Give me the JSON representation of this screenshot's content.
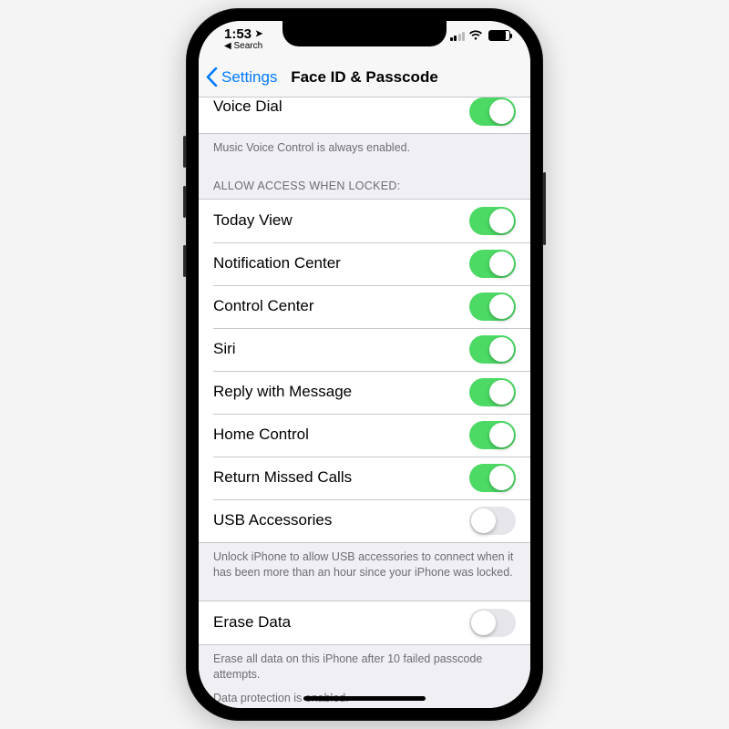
{
  "status": {
    "time": "1:53",
    "breadcrumb": "Search"
  },
  "nav": {
    "back": "Settings",
    "title": "Face ID & Passcode"
  },
  "voiceDial": {
    "label": "Voice Dial",
    "on": true,
    "footer": "Music Voice Control is always enabled."
  },
  "allowAccess": {
    "header": "Allow Access When Locked:",
    "items": [
      {
        "label": "Today View",
        "on": true
      },
      {
        "label": "Notification Center",
        "on": true
      },
      {
        "label": "Control Center",
        "on": true
      },
      {
        "label": "Siri",
        "on": true
      },
      {
        "label": "Reply with Message",
        "on": true
      },
      {
        "label": "Home Control",
        "on": true
      },
      {
        "label": "Return Missed Calls",
        "on": true
      },
      {
        "label": "USB Accessories",
        "on": false
      }
    ],
    "footer": "Unlock iPhone to allow USB accessories to connect when it has been more than an hour since your iPhone was locked."
  },
  "eraseData": {
    "label": "Erase Data",
    "on": false,
    "footer1": "Erase all data on this iPhone after 10 failed passcode attempts.",
    "footer2": "Data protection is enabled."
  }
}
